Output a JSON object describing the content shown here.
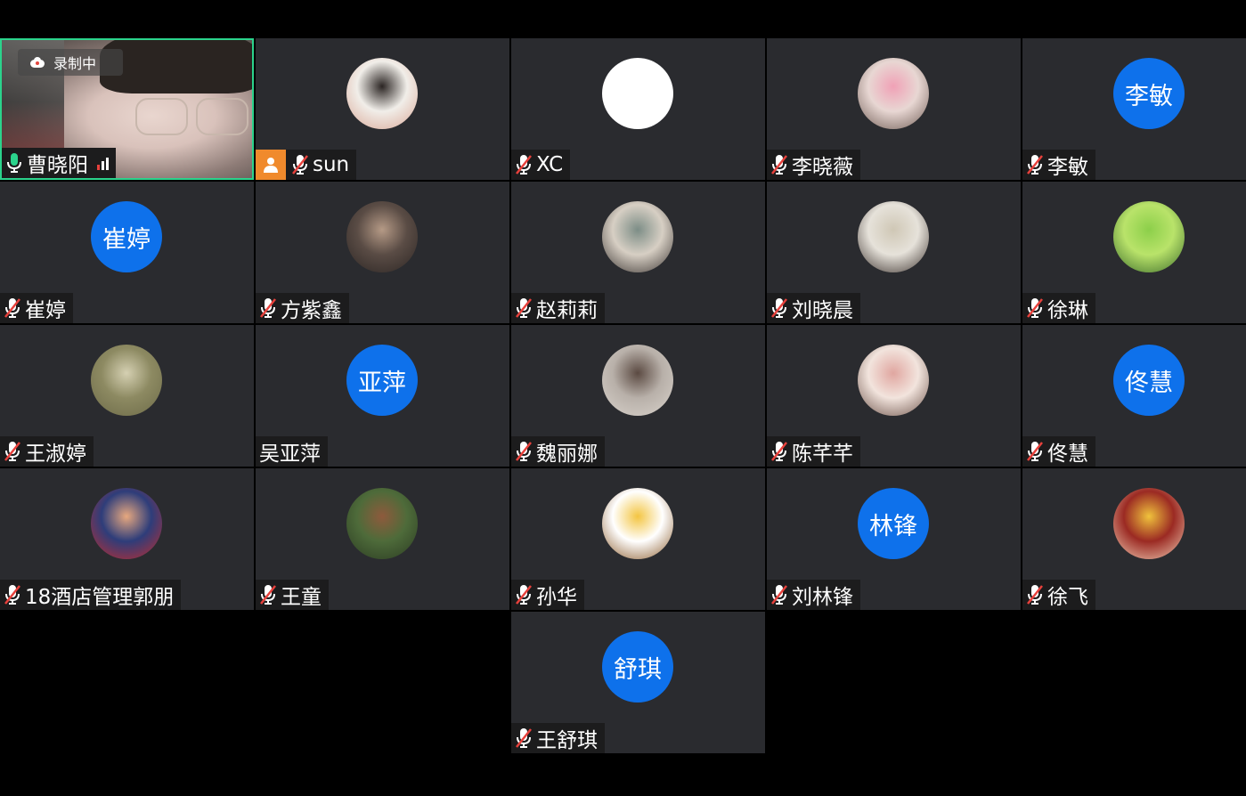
{
  "recording": {
    "label": "录制中"
  },
  "participants": [
    {
      "name": "曹晓阳",
      "avatar": "video",
      "mic": "on",
      "self": true
    },
    {
      "name": "sun",
      "avatar": "photo",
      "mic": "muted",
      "host": true,
      "colors": [
        "#f1eee9",
        "#2b2523",
        "#d9a695"
      ]
    },
    {
      "name": "XC",
      "avatar": "white",
      "mic": "muted"
    },
    {
      "name": "李晓薇",
      "avatar": "photo",
      "mic": "muted",
      "colors": [
        "#e8d7d3",
        "#f0a1b6",
        "#6d5a52"
      ]
    },
    {
      "name": "李敏",
      "avatar": "text",
      "avatar_text": "李敏",
      "mic": "muted"
    },
    {
      "name": "崔婷",
      "avatar": "text",
      "avatar_text": "崔婷",
      "mic": "muted"
    },
    {
      "name": "方紫鑫",
      "avatar": "photo",
      "mic": "muted",
      "colors": [
        "#5a4c45",
        "#b59a86",
        "#2c2624"
      ]
    },
    {
      "name": "赵莉莉",
      "avatar": "photo",
      "mic": "muted",
      "colors": [
        "#d7cfc4",
        "#7c8d86",
        "#3a3431"
      ]
    },
    {
      "name": "刘晓晨",
      "avatar": "photo",
      "mic": "muted",
      "colors": [
        "#e6e2da",
        "#cfc7b5",
        "#3b312d"
      ]
    },
    {
      "name": "徐琳",
      "avatar": "photo",
      "mic": "muted",
      "colors": [
        "#b9e36a",
        "#8ccf4a",
        "#3a6a2a"
      ]
    },
    {
      "name": "王淑婷",
      "avatar": "photo",
      "mic": "muted",
      "colors": [
        "#8d8a62",
        "#d5d0b2",
        "#6c6a48"
      ]
    },
    {
      "name": "吴亚萍",
      "avatar": "text",
      "avatar_text": "亚萍",
      "mic": "none"
    },
    {
      "name": "魏丽娜",
      "avatar": "photo",
      "mic": "muted",
      "colors": [
        "#b8b0a9",
        "#5b4a42",
        "#d9d3cc"
      ]
    },
    {
      "name": "陈芊芊",
      "avatar": "photo",
      "mic": "muted",
      "colors": [
        "#f2e4dd",
        "#e0a6a0",
        "#6b5148"
      ]
    },
    {
      "name": "佟慧",
      "avatar": "text",
      "avatar_text": "佟慧",
      "mic": "muted"
    },
    {
      "name": "18酒店管理郭朋",
      "avatar": "photo",
      "mic": "muted",
      "colors": [
        "#2e3d7a",
        "#e7a87f",
        "#c42c2c"
      ]
    },
    {
      "name": "王童",
      "avatar": "photo",
      "mic": "muted",
      "colors": [
        "#4e6b3a",
        "#8e5a3c",
        "#2b3b22"
      ]
    },
    {
      "name": "孙华",
      "avatar": "photo",
      "mic": "muted",
      "colors": [
        "#ffffff",
        "#f3c542",
        "#8a5a2a"
      ]
    },
    {
      "name": "刘林锋",
      "avatar": "text",
      "avatar_text": "林锋",
      "mic": "muted"
    },
    {
      "name": "徐飞",
      "avatar": "photo",
      "mic": "muted",
      "colors": [
        "#9b2a23",
        "#f0c23c",
        "#f3d1b8"
      ]
    },
    {
      "name": "王舒琪",
      "avatar": "text",
      "avatar_text": "舒琪",
      "mic": "muted"
    }
  ]
}
